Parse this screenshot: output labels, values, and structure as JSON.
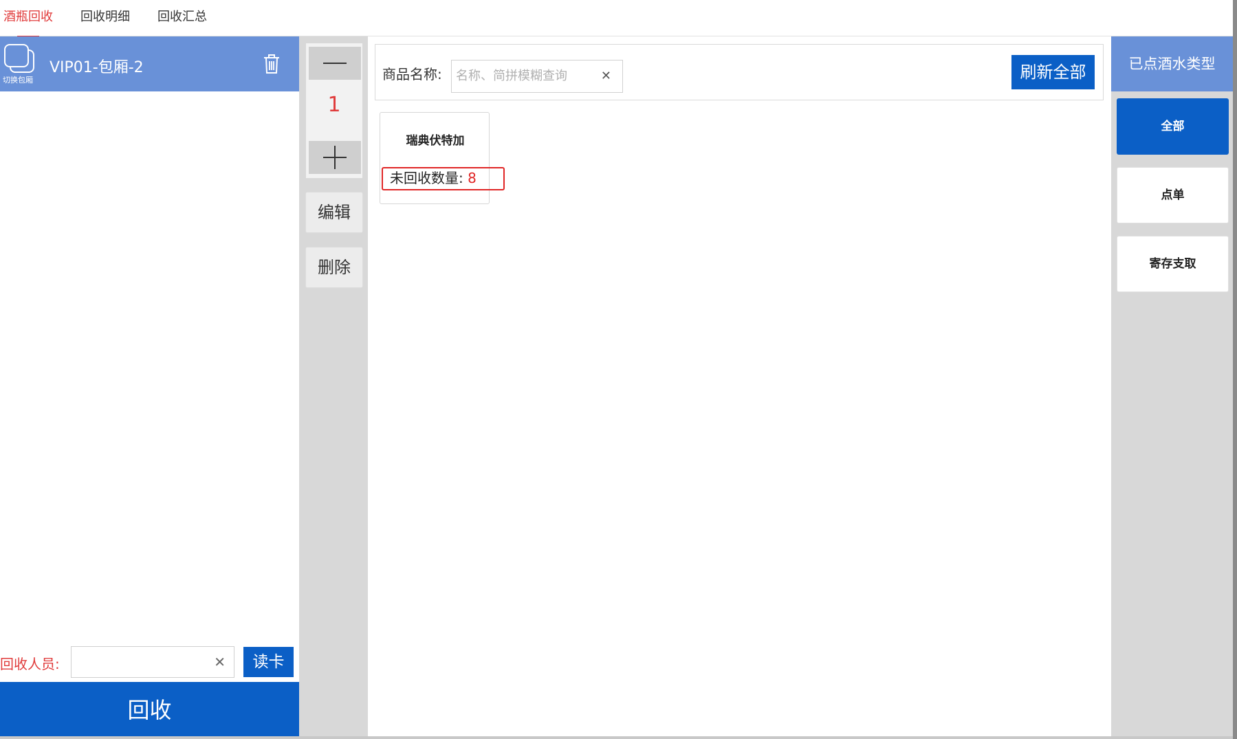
{
  "tabs": [
    {
      "label": "酒瓶回收",
      "active": true
    },
    {
      "label": "回收明细",
      "active": false
    },
    {
      "label": "回收汇总",
      "active": false
    }
  ],
  "left": {
    "switch_label": "切换包厢",
    "room_name": "VIP01-包厢-2",
    "collector_label": "回收人员:",
    "collector_value": "",
    "read_card_label": "读卡",
    "recycle_label": "回收"
  },
  "qty": {
    "value": "1",
    "edit_label": "编辑",
    "delete_label": "删除"
  },
  "search": {
    "label": "商品名称:",
    "placeholder": "名称、简拼模糊查询",
    "value": "",
    "refresh_label": "刷新全部"
  },
  "products": [
    {
      "name": "瑞典伏特加",
      "qty_label": "未回收数量:",
      "qty_value": "8"
    }
  ],
  "right": {
    "header": "已点酒水类型",
    "categories": [
      {
        "label": "全部",
        "active": true
      },
      {
        "label": "点单",
        "active": false
      },
      {
        "label": "寄存支取",
        "active": false
      }
    ]
  },
  "icons": {
    "switch": "switch-room-icon",
    "trash": "trash-icon",
    "clear": "clear-icon",
    "minus": "minus-icon",
    "plus": "plus-icon"
  },
  "colors": {
    "accent_blue": "#0b5fc6",
    "header_blue": "#6991d8",
    "active_red": "#e03a3a"
  }
}
